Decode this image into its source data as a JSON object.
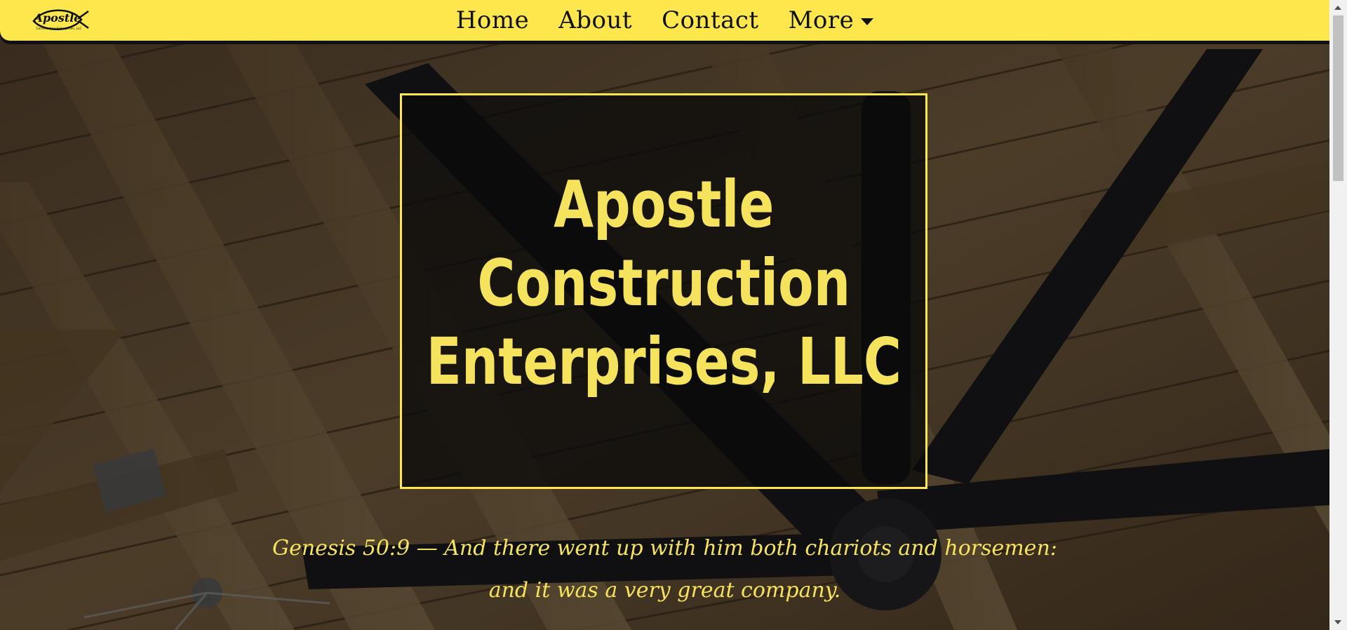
{
  "site": {
    "logo_text": "Apostle",
    "logo_subtext": "Construction Enterprises, LLC"
  },
  "nav": {
    "items": [
      {
        "label": "Home"
      },
      {
        "label": "About"
      },
      {
        "label": "Contact"
      },
      {
        "label": "More"
      }
    ]
  },
  "hero": {
    "title_lines": [
      "Apostle",
      "Construction",
      "Enterprises, LLC"
    ],
    "verse": "Genesis 50:9 — And there went up with him both chariots and horsemen: and it was a very great company."
  },
  "colors": {
    "accent": "#fde74c",
    "title_text": "#f5e35e",
    "nav_text": "#111111"
  }
}
